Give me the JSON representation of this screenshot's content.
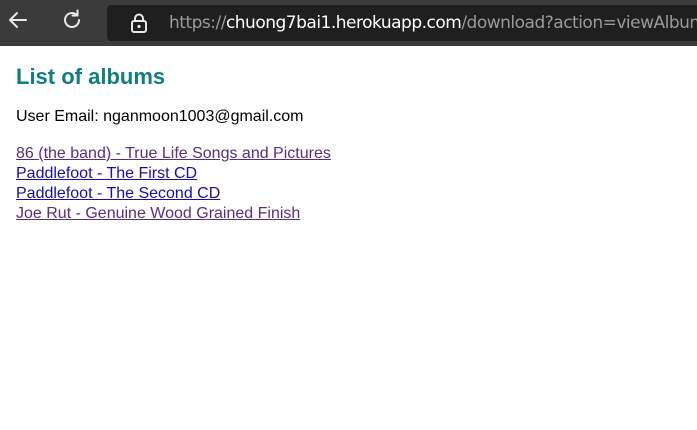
{
  "browser": {
    "url_scheme": "https://",
    "url_host": "chuong7bai1.herokuapp.com",
    "url_path": "/download?action=viewAlbums",
    "icons": {
      "back": "back-arrow-icon",
      "reload": "reload-icon",
      "lock": "lock-icon"
    }
  },
  "page": {
    "title": "List of albums",
    "user_email_line": "User Email: nganmoon1003@gmail.com",
    "albums": [
      {
        "label": "86 (the band) - True Life Songs and Pictures",
        "visited": true
      },
      {
        "label": "Paddlefoot - The First CD",
        "visited": false
      },
      {
        "label": "Paddlefoot - The Second CD",
        "visited": false
      },
      {
        "label": "Joe Rut - Genuine Wood Grained Finish",
        "visited": true
      }
    ]
  },
  "colors": {
    "title": "#0f7e7e",
    "link_unvisited": "#1a0dab",
    "link_visited": "#5a2d80",
    "toolbar_bg": "#3b3b3b",
    "address_bg": "#1f1f1f"
  }
}
